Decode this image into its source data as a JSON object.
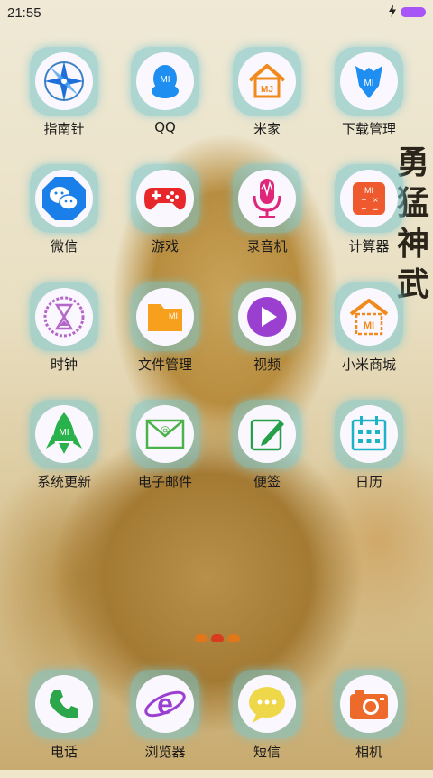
{
  "status": {
    "time": "21:55",
    "charging_icon": "lightning-icon",
    "battery_color": "#a855f7"
  },
  "wallpaper_text": [
    "勇",
    "猛",
    "神",
    "武"
  ],
  "apps": [
    {
      "label": "指南针",
      "icon": "compass-icon"
    },
    {
      "label": "QQ",
      "icon": "qq-penguin-icon"
    },
    {
      "label": "米家",
      "icon": "mijia-house-icon"
    },
    {
      "label": "下载管理",
      "icon": "download-manager-icon"
    },
    {
      "label": "微信",
      "icon": "wechat-icon"
    },
    {
      "label": "游戏",
      "icon": "gamepad-icon"
    },
    {
      "label": "录音机",
      "icon": "microphone-icon"
    },
    {
      "label": "计算器",
      "icon": "calculator-icon"
    },
    {
      "label": "时钟",
      "icon": "hourglass-clock-icon"
    },
    {
      "label": "文件管理",
      "icon": "folder-icon"
    },
    {
      "label": "视频",
      "icon": "play-icon"
    },
    {
      "label": "小米商城",
      "icon": "mi-store-icon"
    },
    {
      "label": "系统更新",
      "icon": "rocket-update-icon"
    },
    {
      "label": "电子邮件",
      "icon": "envelope-icon"
    },
    {
      "label": "便签",
      "icon": "notes-pen-icon"
    },
    {
      "label": "日历",
      "icon": "calendar-icon"
    }
  ],
  "dock": [
    {
      "label": "电话",
      "icon": "phone-icon"
    },
    {
      "label": "浏览器",
      "icon": "browser-e-icon"
    },
    {
      "label": "短信",
      "icon": "message-bubble-icon"
    },
    {
      "label": "相机",
      "icon": "camera-icon"
    }
  ],
  "page_indicator": {
    "pages": 3,
    "current": 2,
    "colors": [
      "#e0771a",
      "#d93b1e",
      "#e0771a"
    ]
  },
  "icon_text": {
    "mi": "MI"
  }
}
